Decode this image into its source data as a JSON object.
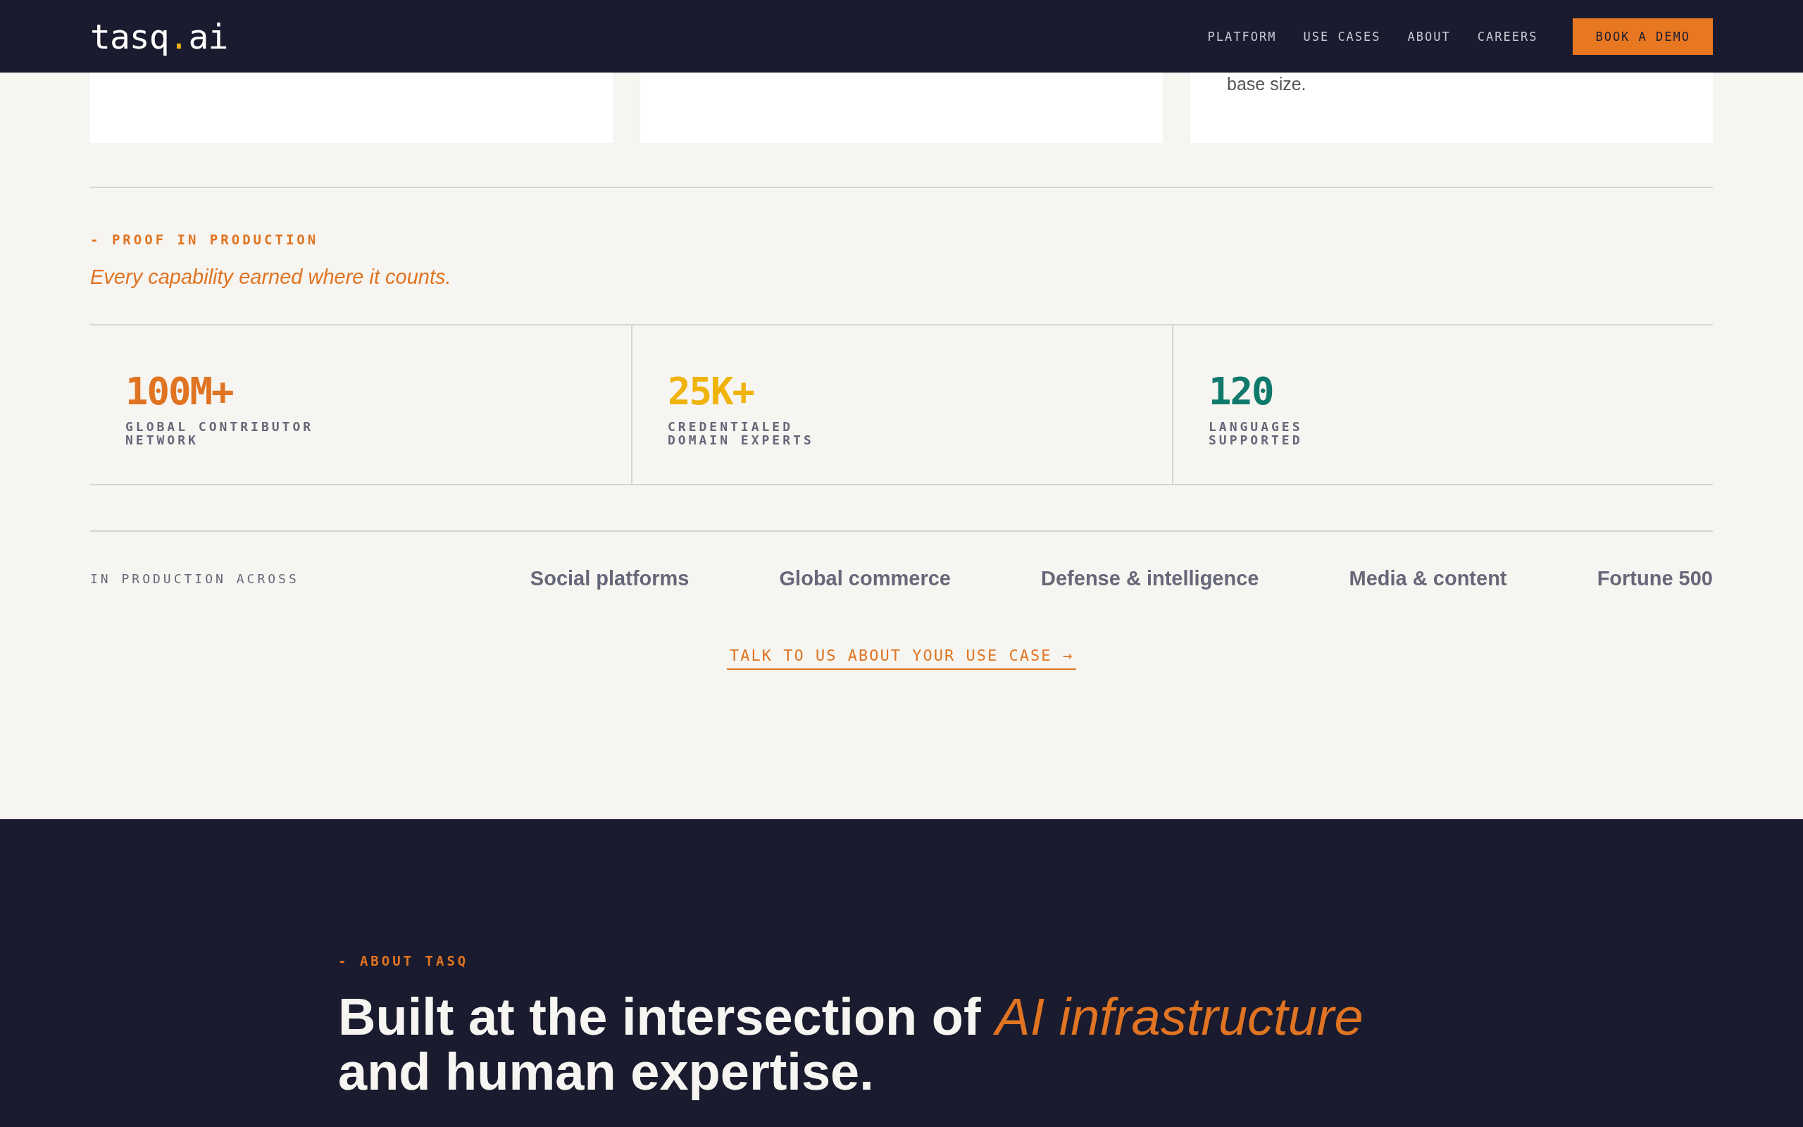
{
  "header": {
    "logo": {
      "name": "tasq",
      "dot": ".",
      "suffix": "ai"
    },
    "nav": [
      "PLATFORM",
      "USE CASES",
      "ABOUT",
      "CAREERS"
    ],
    "cta": "BOOK A DEMO"
  },
  "cards": [
    {
      "kind": "empty"
    },
    {
      "kind": "empty"
    },
    {
      "kind": "text",
      "text": "base size."
    }
  ],
  "proof": {
    "eyebrow": "- PROOF IN PRODUCTION",
    "tagline": "Every capability earned where it counts.",
    "stats": [
      {
        "value": "100M+",
        "label": "GLOBAL CONTRIBUTOR NETWORK",
        "color": "#e07422"
      },
      {
        "value": "25K+",
        "label": "CREDENTIALED DOMAIN EXPERTS",
        "color": "#f0b30a"
      },
      {
        "value": "120",
        "label": "LANGUAGES SUPPORTED",
        "color": "#0f7a6b"
      }
    ]
  },
  "production": {
    "label": "IN PRODUCTION ACROSS",
    "sectors": [
      "Social platforms",
      "Global commerce",
      "Defense & intelligence",
      "Media & content",
      "Fortune 500"
    ]
  },
  "link": "TALK TO US ABOUT YOUR USE CASE →",
  "about": {
    "eyebrow": "- ABOUT TASQ",
    "heading": "Built at the intersection of *AI infrastructure* and human expertise."
  }
}
